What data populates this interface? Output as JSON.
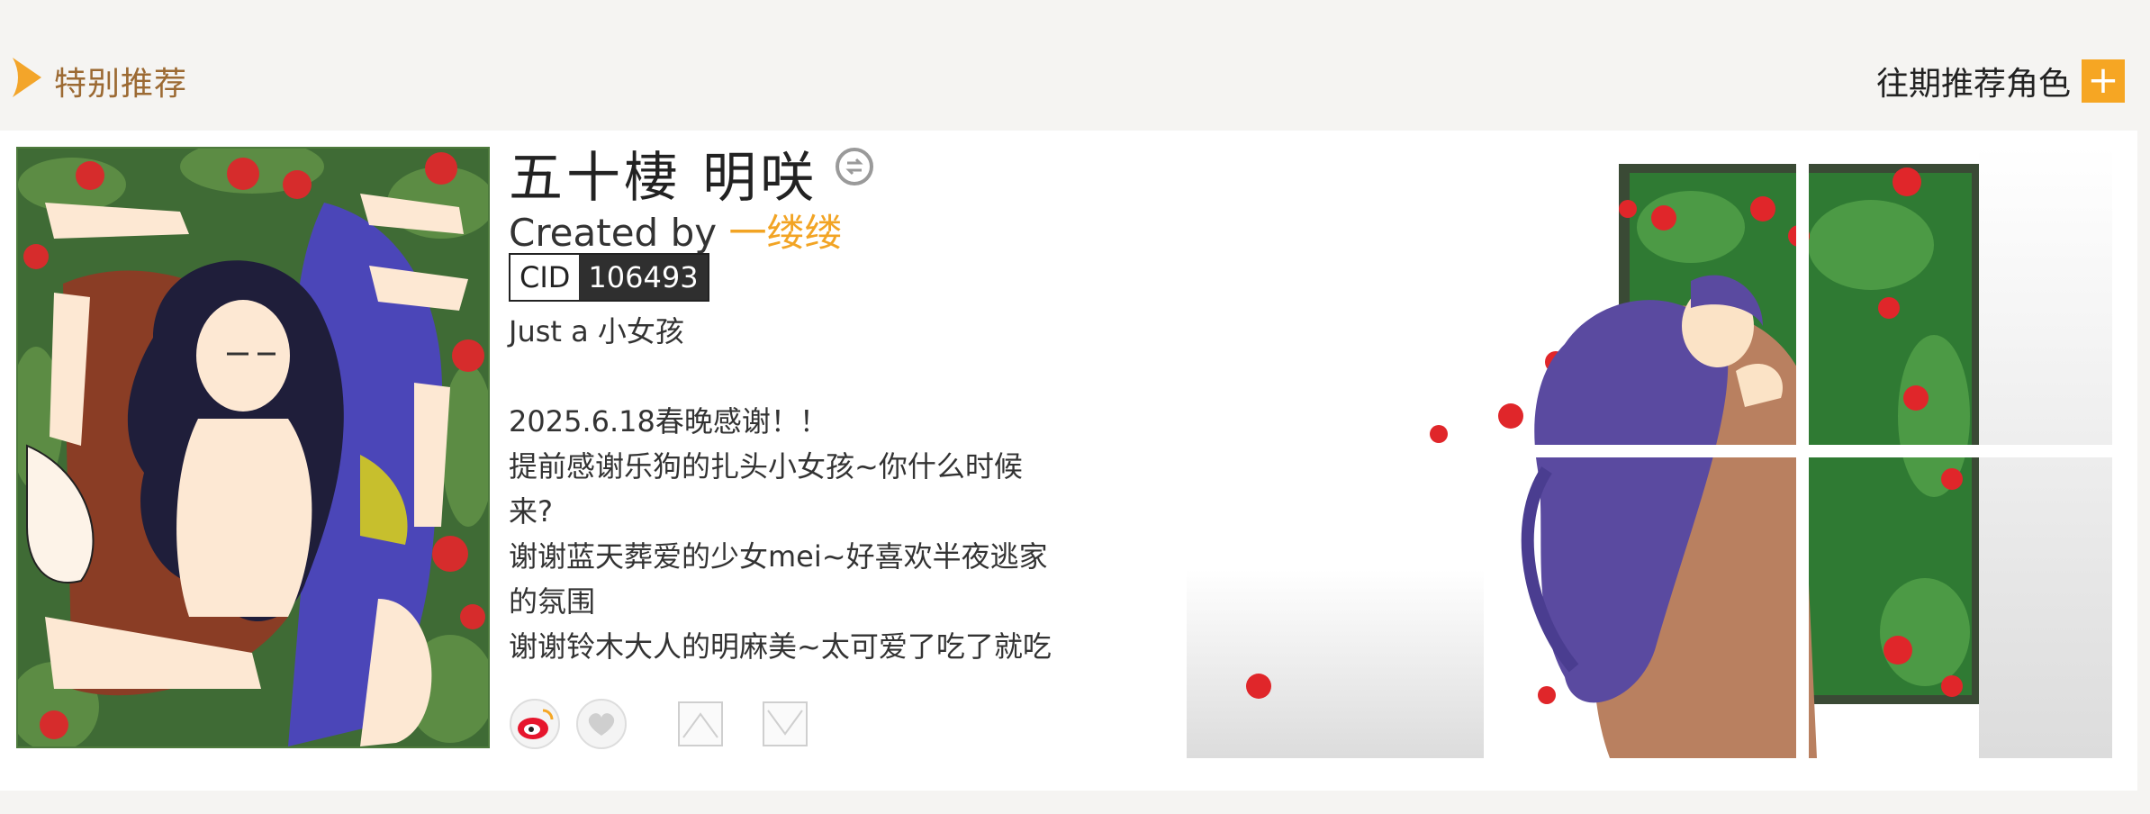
{
  "section": {
    "title": "特别推荐",
    "past_label": "往期推荐角色",
    "plus_symbol": "+",
    "accent_color": "#f6a623",
    "title_color": "#9c6a33"
  },
  "character": {
    "name": "五十棲 明咲",
    "created_prefix": "Created by ",
    "creator": "一缕缕",
    "cid_label": "CID",
    "cid_value": "106493",
    "desc_lines": [
      "Just a 小女孩",
      "",
      "2025.6.18春晚感谢！！",
      "提前感谢乐狗的扎头小女孩~你什么时候",
      "来?",
      "谢谢蓝天葬爱的少女mei~好喜欢半夜逃家",
      "的氛围",
      "谢谢铃木大人的明麻美~太可爱了吃了就吃"
    ]
  },
  "icons": {
    "chevron": "chevron-right-icon",
    "badge": "swap-badge-icon",
    "weibo": "weibo-icon",
    "like": "heart-icon",
    "up": "arrow-up-icon",
    "down": "arrow-down-icon"
  }
}
